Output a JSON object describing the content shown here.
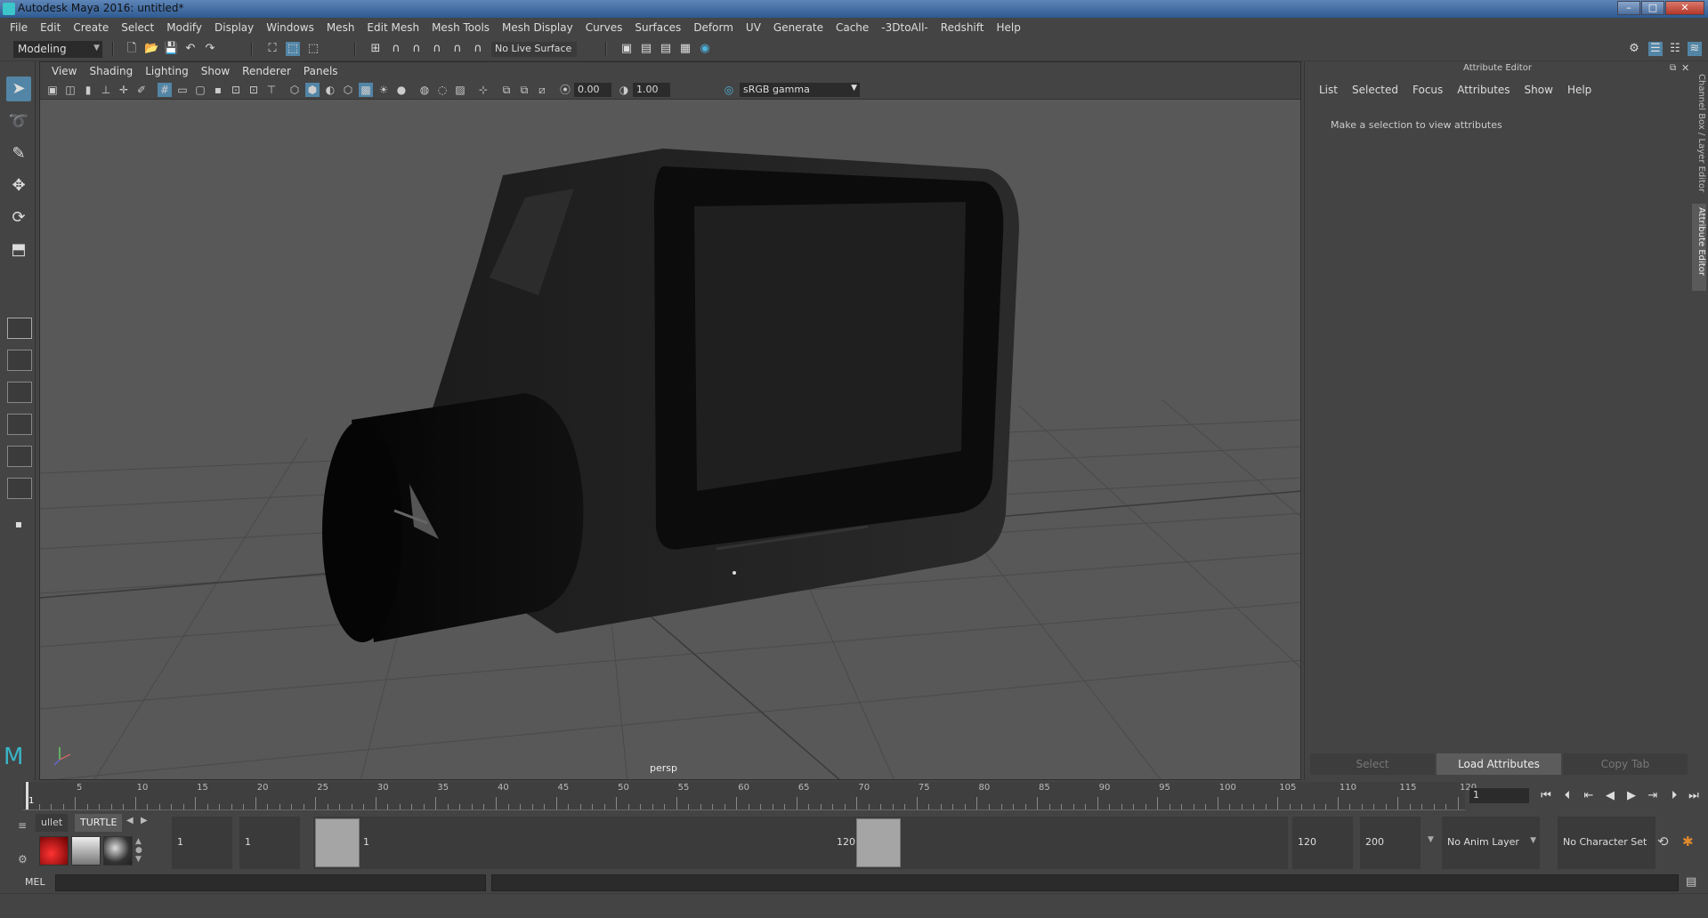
{
  "app": {
    "title": "Autodesk Maya 2016: untitled*"
  },
  "menubar": [
    "File",
    "Edit",
    "Create",
    "Select",
    "Modify",
    "Display",
    "Windows",
    "Mesh",
    "Edit Mesh",
    "Mesh Tools",
    "Mesh Display",
    "Curves",
    "Surfaces",
    "Deform",
    "UV",
    "Generate",
    "Cache",
    "-3DtoAll-",
    "Redshift",
    "Help"
  ],
  "toolbar": {
    "mode": "Modeling",
    "live_surface": "No Live Surface"
  },
  "viewport": {
    "menu": [
      "View",
      "Shading",
      "Lighting",
      "Show",
      "Renderer",
      "Panels"
    ],
    "near_value": "0.00",
    "far_value": "1.00",
    "color_space": "sRGB gamma",
    "camera_label": "persp"
  },
  "attribute_editor": {
    "header": "Attribute Editor",
    "menu": [
      "List",
      "Selected",
      "Focus",
      "Attributes",
      "Show",
      "Help"
    ],
    "message": "Make a selection to view attributes",
    "buttons": {
      "select": "Select",
      "load": "Load Attributes",
      "copy": "Copy Tab"
    }
  },
  "side_tabs": {
    "channel_box": "Channel Box / Layer Editor",
    "attribute_editor": "Attribute Editor"
  },
  "timeline": {
    "ticks": [
      "1",
      "5",
      "10",
      "15",
      "20",
      "25",
      "30",
      "35",
      "40",
      "45",
      "50",
      "55",
      "60",
      "65",
      "70",
      "75",
      "80",
      "85",
      "90",
      "95",
      "100",
      "105",
      "110",
      "115",
      "120"
    ],
    "current_frame": "1"
  },
  "range": {
    "shelf_tabs": [
      "ullet",
      "TURTLE"
    ],
    "start_min": "1",
    "start": "1",
    "range_start_label": "1",
    "range_end_label": "120",
    "end": "120",
    "end_max": "200",
    "anim_layer": "No Anim Layer",
    "character_set": "No Character Set"
  },
  "command_line": {
    "label": "MEL"
  }
}
